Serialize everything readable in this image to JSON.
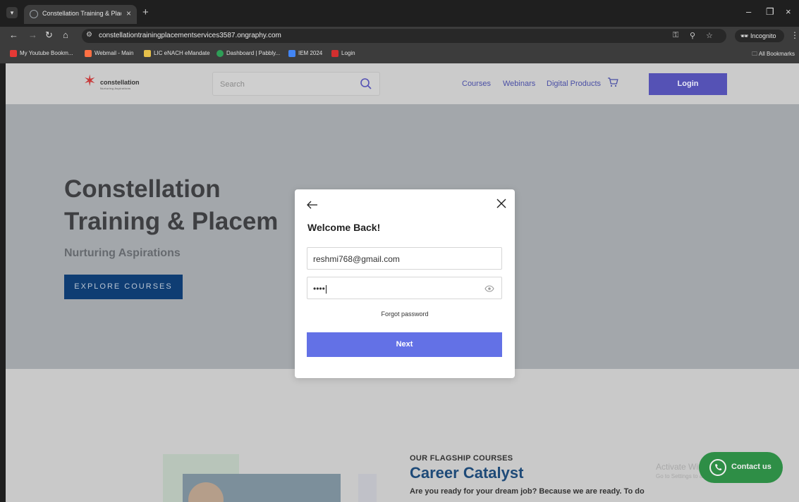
{
  "browser": {
    "tab_title": "Constellation Training & Placem",
    "new_tab": "+",
    "url": "constellationtrainingplacementservices3587.ongraphy.com",
    "incognito_label": "Incognito",
    "bookmarks": [
      {
        "label": "My Youtube Bookm...",
        "color": "#e53935"
      },
      {
        "label": "Webmail - Main",
        "color": "#ff7043"
      },
      {
        "label": "LIC eNACH eMandate",
        "color": "#e6c04a"
      },
      {
        "label": "Dashboard | Pabbly...",
        "color": "#2e9e57"
      },
      {
        "label": "IEM 2024",
        "color": "#4285f4"
      },
      {
        "label": "Login",
        "color": "#d32f2f"
      }
    ],
    "all_bookmarks": "All Bookmarks"
  },
  "site": {
    "logo_text": "constellation",
    "logo_sub": "Nurturing Aspirations",
    "search_placeholder": "Search",
    "nav": [
      "Courses",
      "Webinars",
      "Digital Products"
    ],
    "login_label": "Login",
    "brand_color": "#5552b5"
  },
  "hero": {
    "title_line1": "Constellation",
    "title_line2": "Training & Placem",
    "subtitle": "Nurturing Aspirations",
    "cta": "EXPLORE COURSES"
  },
  "section": {
    "label": "OUR FLAGSHIP COURSES",
    "title": "Career Catalyst",
    "desc": "Are you ready for your dream job? Because we are ready. To do"
  },
  "watermark": {
    "line1": "Activate Windows",
    "line2": "Go to Settings to activate Windows."
  },
  "contact_label": "Contact us",
  "modal": {
    "title": "Welcome Back!",
    "email_value": "reshmi768@gmail.com",
    "password_value": "••••",
    "forgot_label": "Forgot password",
    "next_label": "Next",
    "button_color": "#6371e6"
  }
}
